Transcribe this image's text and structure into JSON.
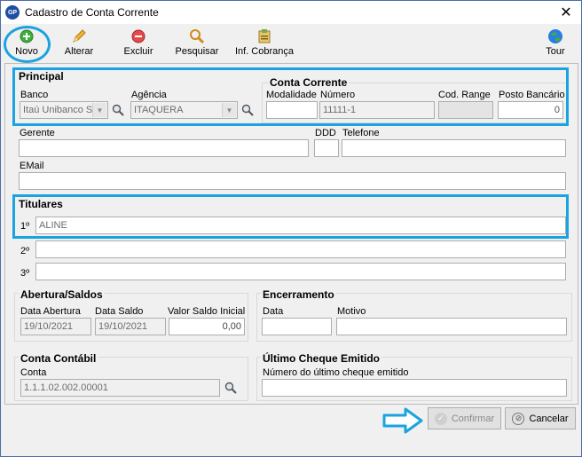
{
  "window": {
    "title": "Cadastro de Conta Corrente",
    "app_badge": "GP"
  },
  "toolbar": {
    "novo": "Novo",
    "alterar": "Alterar",
    "excluir": "Excluir",
    "pesquisar": "Pesquisar",
    "inf_cobranca": "Inf. Cobrança",
    "tour": "Tour"
  },
  "principal": {
    "title": "Principal",
    "banco_label": "Banco",
    "banco_value": "Itaú Unibanco S",
    "agencia_label": "Agência",
    "agencia_value": "ITAQUERA",
    "conta_corrente": {
      "title": "Conta Corrente",
      "modalidade_label": "Modalidade",
      "modalidade_value": "",
      "numero_label": "Número",
      "numero_value": "11111-1",
      "cod_range_label": "Cod. Range",
      "cod_range_value": "",
      "posto_label": "Posto Bancário",
      "posto_value": "0"
    }
  },
  "contato": {
    "gerente_label": "Gerente",
    "gerente_value": "",
    "ddd_label": "DDD",
    "ddd_value": "",
    "telefone_label": "Telefone",
    "telefone_value": "",
    "email_label": "EMail",
    "email_value": ""
  },
  "titulares": {
    "title": "Titulares",
    "items": [
      {
        "label": "1º",
        "value": "ALINE"
      },
      {
        "label": "2º",
        "value": ""
      },
      {
        "label": "3º",
        "value": ""
      }
    ]
  },
  "abertura": {
    "title": "Abertura/Saldos",
    "data_abertura_label": "Data Abertura",
    "data_abertura_value": "19/10/2021",
    "data_saldo_label": "Data Saldo",
    "data_saldo_value": "19/10/2021",
    "valor_saldo_label": "Valor Saldo Inicial",
    "valor_saldo_value": "0,00"
  },
  "encerramento": {
    "title": "Encerramento",
    "data_label": "Data",
    "data_value": "",
    "motivo_label": "Motivo",
    "motivo_value": ""
  },
  "conta_contabil": {
    "title": "Conta Contábil",
    "conta_label": "Conta",
    "conta_value": "1.1.1.02.002.00001"
  },
  "ultimo_cheque": {
    "title": "Último Cheque Emitido",
    "numero_label": "Número do último cheque emitido",
    "numero_value": ""
  },
  "actions": {
    "confirmar": "Confirmar",
    "cancelar": "Cancelar"
  },
  "colors": {
    "highlight": "#1aa3e0",
    "window_border": "#4a6ea9"
  }
}
